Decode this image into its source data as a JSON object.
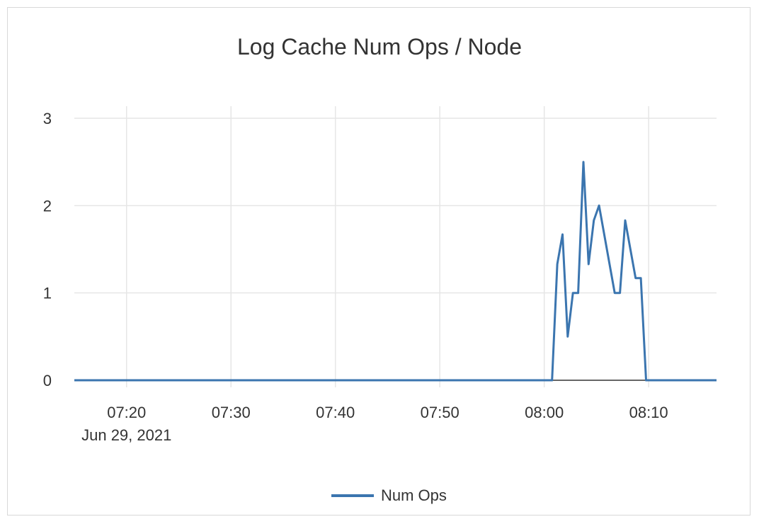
{
  "chart_data": {
    "type": "line",
    "title": "Log Cache Num Ops / Node",
    "x_start": "Jun 29, 2021 07:15",
    "x_tick_labels": [
      "07:20",
      "07:30",
      "07:40",
      "07:50",
      "08:00",
      "08:10"
    ],
    "x_date_label": "Jun 29, 2021",
    "xlim": [
      "07:15:00",
      "08:16:30"
    ],
    "ylim": [
      0,
      3
    ],
    "y_ticks": [
      0,
      1,
      2,
      3
    ],
    "grid": true,
    "legend": "bottom",
    "series": [
      {
        "name": "Num Ops",
        "color": "#3b75af",
        "points": [
          [
            "07:15:00",
            0
          ],
          [
            "08:00:45",
            0
          ],
          [
            "08:01:15",
            1.33
          ],
          [
            "08:01:45",
            1.67
          ],
          [
            "08:02:15",
            0.5
          ],
          [
            "08:02:45",
            1.0
          ],
          [
            "08:03:15",
            1.0
          ],
          [
            "08:03:45",
            2.5
          ],
          [
            "08:04:15",
            1.33
          ],
          [
            "08:04:45",
            1.83
          ],
          [
            "08:05:15",
            2.0
          ],
          [
            "08:06:45",
            1.0
          ],
          [
            "08:07:15",
            1.0
          ],
          [
            "08:07:45",
            1.83
          ],
          [
            "08:08:45",
            1.17
          ],
          [
            "08:09:15",
            1.17
          ],
          [
            "08:09:45",
            0
          ],
          [
            "08:16:30",
            0
          ]
        ]
      }
    ]
  },
  "colors": {
    "grid": "#e6e6e6",
    "axis_line": "#333333",
    "text": "#333333"
  }
}
